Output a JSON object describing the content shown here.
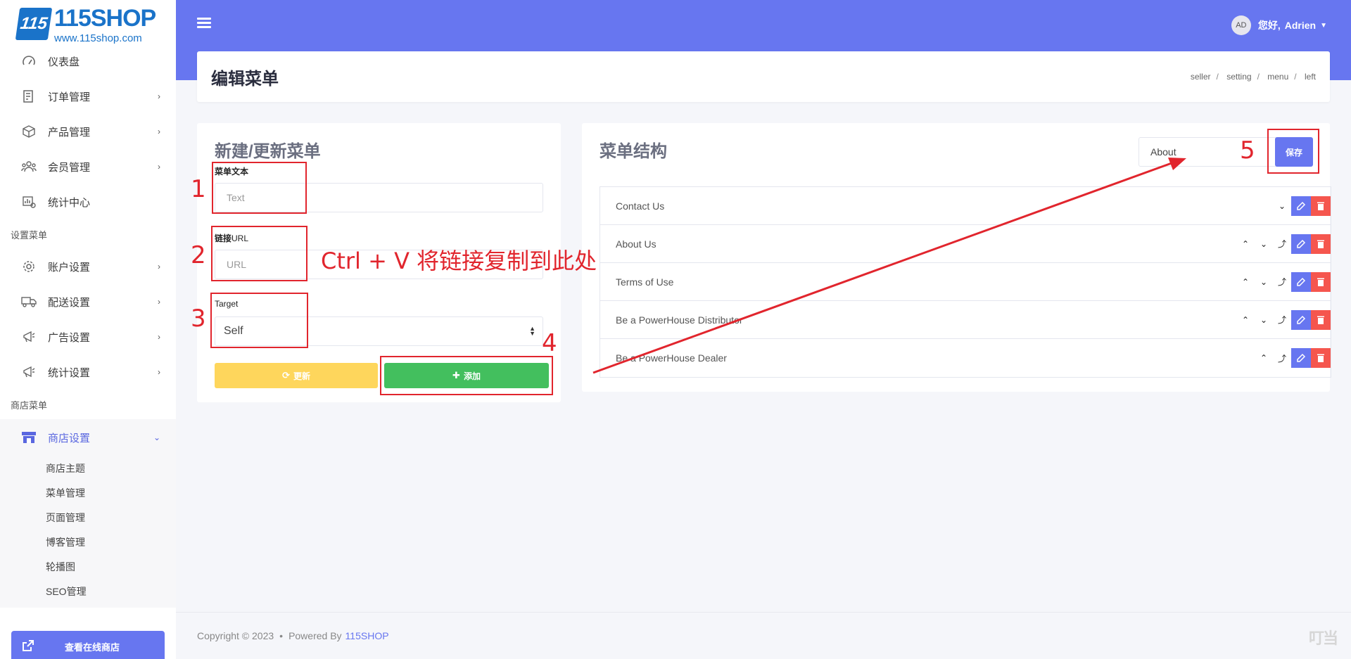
{
  "brand": {
    "logo_mark": "115",
    "logo_title": "115SHOP",
    "logo_url": "www.115shop.com"
  },
  "sidebar": {
    "items_top": [
      {
        "label": "仪表盘",
        "icon": "gauge-icon",
        "chevron": false
      },
      {
        "label": "订单管理",
        "icon": "order-icon",
        "chevron": true
      },
      {
        "label": "产品管理",
        "icon": "box-icon",
        "chevron": true
      },
      {
        "label": "会员管理",
        "icon": "users-icon",
        "chevron": true
      },
      {
        "label": "统计中心",
        "icon": "stats-icon",
        "chevron": false
      }
    ],
    "section_settings": "设置菜单",
    "items_settings": [
      {
        "label": "账户设置",
        "icon": "gear-icon"
      },
      {
        "label": "配送设置",
        "icon": "truck-icon"
      },
      {
        "label": "广告设置",
        "icon": "megaphone-icon"
      },
      {
        "label": "统计设置",
        "icon": "megaphone-icon"
      }
    ],
    "section_shop": "商店菜单",
    "shop_settings": {
      "label": "商店设置",
      "icon": "store-icon"
    },
    "sub_items": [
      "商店主题",
      "菜单管理",
      "页面管理",
      "博客管理",
      "轮播图",
      "SEO管理"
    ],
    "visit_button": "查看在线商店"
  },
  "header": {
    "avatar": "AD",
    "greeting": "您好,",
    "username": "Adrien"
  },
  "page": {
    "title": "编辑菜单",
    "breadcrumb": [
      "seller",
      "setting",
      "menu",
      "left"
    ]
  },
  "form": {
    "title": "新建/更新菜单",
    "text_label": "菜单文本",
    "text_placeholder": "Text",
    "url_label_prefix": "链接",
    "url_label_suffix": "URL",
    "url_placeholder": "URL",
    "target_label": "Target",
    "target_value": "Self",
    "update_button": "更新",
    "add_button": "添加"
  },
  "structure": {
    "title": "菜单结构",
    "menu_name_value": "About",
    "save_button": "保存",
    "items": [
      {
        "label": "Contact Us",
        "controls": [
          "down"
        ]
      },
      {
        "label": "About Us",
        "controls": [
          "up",
          "down",
          "out"
        ]
      },
      {
        "label": "Terms of Use",
        "controls": [
          "up",
          "down",
          "out"
        ]
      },
      {
        "label": "Be a PowerHouse Distributor",
        "controls": [
          "up",
          "down",
          "out"
        ]
      },
      {
        "label": "Be a PowerHouse Dealer",
        "controls": [
          "up",
          "out"
        ]
      }
    ]
  },
  "footer": {
    "copyright": "Copyright © 2023",
    "powered": "Powered By",
    "brand": "115SHOP",
    "watermark": "叮当"
  },
  "annotations": {
    "n1": "1",
    "n2": "2",
    "n3": "3",
    "n4": "4",
    "n5": "5",
    "hint": "Ctrl + V 将链接复制到此处",
    "color": "#e1252d"
  },
  "colors": {
    "primary": "#6776f0",
    "warning": "#fed65c",
    "success": "#43bf5e",
    "danger": "#f5564e"
  }
}
